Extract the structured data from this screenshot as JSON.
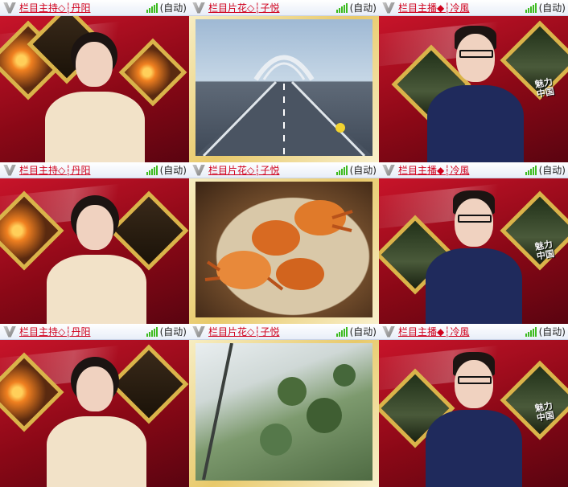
{
  "tiles": [
    {
      "name": "栏目主持◇┆丹阳",
      "mode": "(自动)"
    },
    {
      "name": "栏目片花◇┆子悦",
      "mode": "(自动)"
    },
    {
      "name": "栏目主播◆┆冷風",
      "mode": "(自动)"
    },
    {
      "name": "栏目主持◇┆丹阳",
      "mode": "(自动)"
    },
    {
      "name": "栏目片花◇┆子悦",
      "mode": "(自动)"
    },
    {
      "name": "栏目主播◆┆冷風",
      "mode": "(自动)"
    },
    {
      "name": "栏目主持◇┆丹阳",
      "mode": "(自动)"
    },
    {
      "name": "栏目片花◇┆子悦",
      "mode": "(自动)"
    },
    {
      "name": "栏目主播◆┆冷風",
      "mode": "(自动)"
    }
  ],
  "watermark": {
    "line1": "魅力",
    "line2": "中国"
  },
  "icons": {
    "logo": "v-logo-icon",
    "signal": "signal-bars-icon"
  },
  "colors": {
    "name_text": "#d0001c",
    "signal": "#3dbb1f",
    "studio_red": "#c8142a",
    "frame_gold": "#d9b44a"
  }
}
